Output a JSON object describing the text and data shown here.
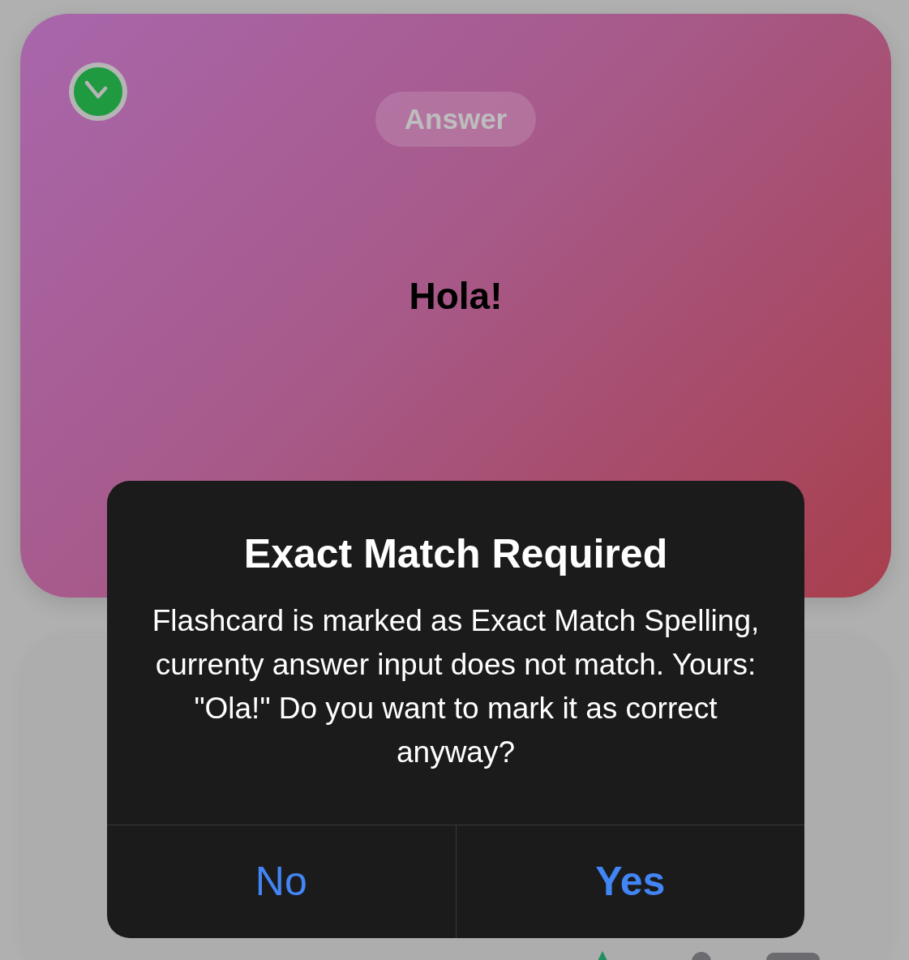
{
  "card": {
    "label": "Answer",
    "text": "Hola!"
  },
  "alert": {
    "title": "Exact Match Required",
    "message": "Flashcard is marked as Exact Match Spelling, currenty answer input does not match. Yours: \"Ola!\" Do you want to mark it as correct anyway?",
    "buttons": [
      {
        "label": "No",
        "kind": "cancel"
      },
      {
        "label": "Yes",
        "kind": "default"
      }
    ]
  }
}
